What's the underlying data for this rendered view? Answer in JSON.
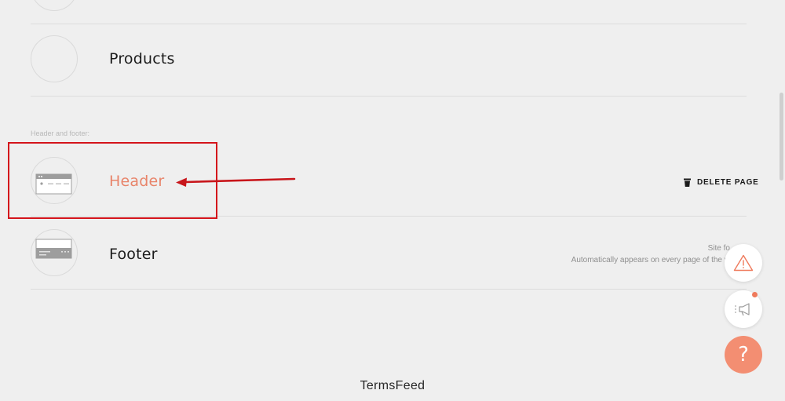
{
  "sections": {
    "header_footer_label": "Header and footer:"
  },
  "rows": {
    "products": {
      "title": "Products"
    },
    "header": {
      "title": "Header",
      "delete_label": "DELETE PAGE"
    },
    "footer": {
      "title": "Footer",
      "side_title": "Site fo",
      "side_desc": "Automatically appears on every page of the w"
    }
  },
  "watermark": "TermsFeed",
  "colors": {
    "accent": "#e8846a",
    "annotation": "#d4141b",
    "help_button": "#f38e72",
    "background": "#efefef"
  },
  "icons": {
    "delete": "trash-icon",
    "warning": "warning-icon",
    "announcement": "megaphone-icon",
    "help": "question-icon"
  },
  "help_symbol": "?"
}
